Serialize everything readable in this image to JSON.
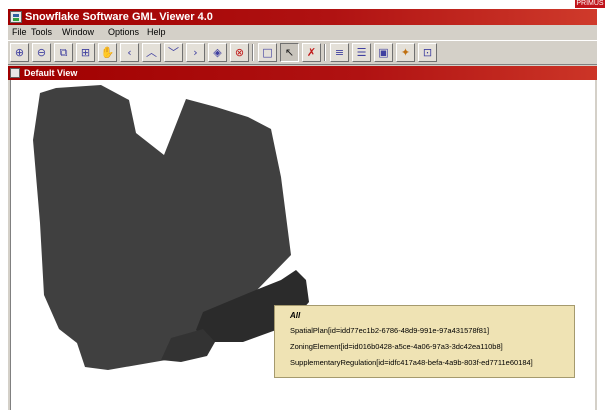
{
  "corner_tag": "PRIMUS",
  "window": {
    "title": "Snowflake Software GML Viewer 4.0"
  },
  "menu": [
    "File",
    "Tools",
    "Window",
    "Options",
    "Help"
  ],
  "toolbar": {
    "buttons": [
      {
        "name": "zoom-in-icon",
        "glyph": "⊕"
      },
      {
        "name": "zoom-out-icon",
        "glyph": "⊖"
      },
      {
        "name": "zoom-window-icon",
        "glyph": "⧉"
      },
      {
        "name": "zoom-extent-icon",
        "glyph": "⊞"
      },
      {
        "name": "pan-icon",
        "glyph": "✋"
      },
      {
        "name": "pan-left-icon",
        "glyph": "‹"
      },
      {
        "name": "pan-up-icon",
        "glyph": "︿"
      },
      {
        "name": "pan-down-icon",
        "glyph": "﹀"
      },
      {
        "name": "pan-right-icon",
        "glyph": "›"
      },
      {
        "name": "recenter-icon",
        "glyph": "◈"
      },
      {
        "name": "stop-icon",
        "glyph": "⊗"
      },
      {
        "name": "select-box-icon",
        "glyph": "□"
      },
      {
        "name": "pointer-icon",
        "glyph": "↖"
      },
      {
        "name": "clear-selection-icon",
        "glyph": "✗"
      },
      {
        "name": "layers-icon",
        "glyph": "≡"
      },
      {
        "name": "attributes-icon",
        "glyph": "☰"
      },
      {
        "name": "map-preview-icon",
        "glyph": "▣"
      },
      {
        "name": "settings-icon",
        "glyph": "✦"
      },
      {
        "name": "export-icon",
        "glyph": "⊡"
      }
    ]
  },
  "view": {
    "title": "Default View"
  },
  "tooltip": {
    "header": "All",
    "lines": [
      "SpatialPlan[id=idd77ec1b2-6786-48d9-991e-97a431578f81]",
      "ZoningElement[id=id016b0428-a5ce-4a06-97a3-3dc42ea110b8]",
      "SupplementaryRegulation[id=idfc417a48-befa-4a9b-803f-ed7711e60184]"
    ]
  },
  "colors": {
    "titlebar": "#a00000",
    "spatial_plan_fill": "#404040",
    "zoning_fill": "#2b2b2b",
    "regulation_fill": "#333333",
    "tooltip_bg": "#efe3b4"
  }
}
